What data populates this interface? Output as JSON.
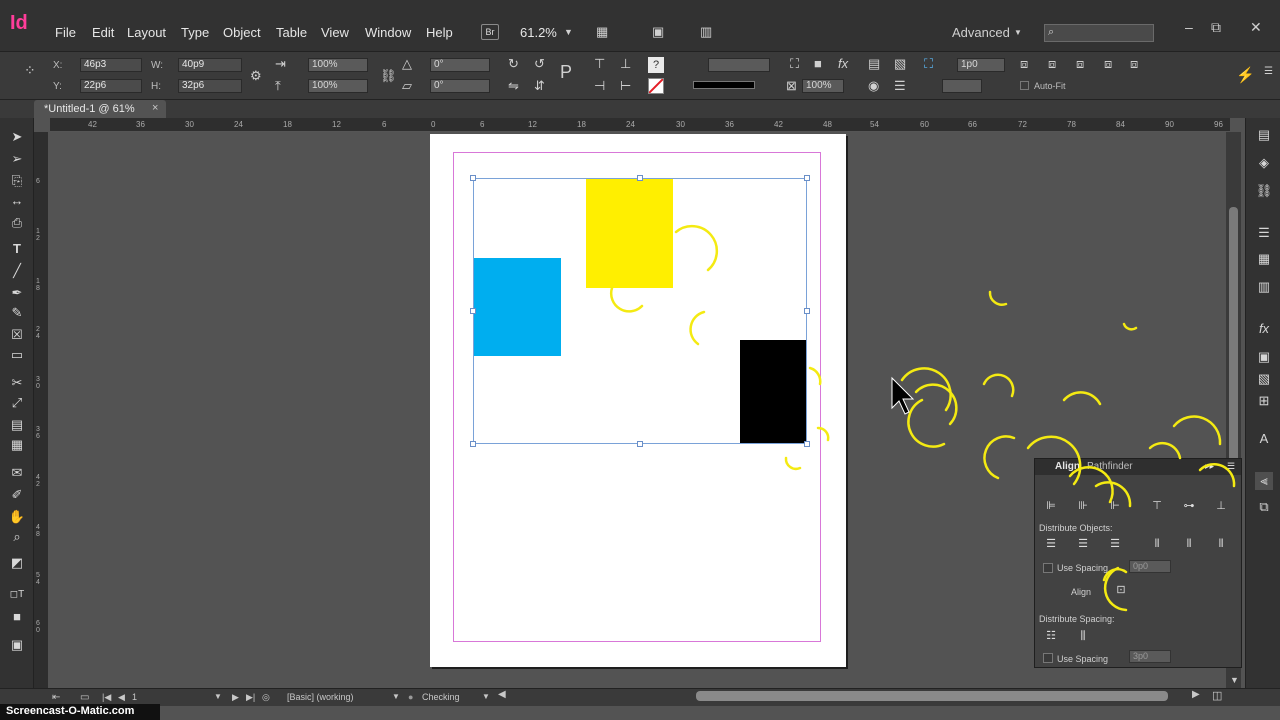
{
  "app": {
    "logo": "Id",
    "zoom": "61.2%",
    "workspace": "Advanced"
  },
  "menu": [
    "File",
    "Edit",
    "Layout",
    "Type",
    "Object",
    "Table",
    "View",
    "Window",
    "Help"
  ],
  "bridge_label": "Br",
  "control": {
    "x_label": "X:",
    "x": "46p3",
    "y_label": "Y:",
    "y": "22p6",
    "w_label": "W:",
    "w": "40p9",
    "h_label": "H:",
    "h": "32p6",
    "scale_x": "100%",
    "scale_y": "100%",
    "angle": "0°",
    "shear": "0°",
    "stroke_weight": "1p0",
    "opacity": "100%",
    "autofit": "Auto-Fit"
  },
  "document_tab": {
    "title": "*Untitled-1 @ 61%",
    "close": "×"
  },
  "ruler": {
    "h": [
      "42",
      "36",
      "30",
      "24",
      "18",
      "12",
      "6",
      "0",
      "6",
      "12",
      "18",
      "24",
      "30",
      "36",
      "42",
      "48",
      "54",
      "60",
      "66",
      "72",
      "78",
      "84",
      "90",
      "96"
    ],
    "v": [
      "6",
      "1 2",
      "1 8",
      "2 4",
      "3 0",
      "3 6",
      "4 2",
      "4 8",
      "5 4",
      "6 0"
    ]
  },
  "colors": {
    "yellow": "#ffef00",
    "cyan": "#00aeef",
    "black": "#000000",
    "margin": "#d877d8",
    "selection": "#7aa2d8"
  },
  "align_panel": {
    "tab_align": "Align",
    "tab_pathfinder": "Pathfinder",
    "distribute_objects": "Distribute Objects:",
    "use_spacing_1": "Use Spacing",
    "spacing_value_1": "0p0",
    "align_to": "Align",
    "distribute_spacing": "Distribute Spacing:",
    "use_spacing_2": "Use Spacing",
    "spacing_value_2": "3p0"
  },
  "status": {
    "page": "1",
    "style": "[Basic] (working)",
    "preflight": "Checking"
  },
  "watermark": "Screencast-O-Matic.com"
}
